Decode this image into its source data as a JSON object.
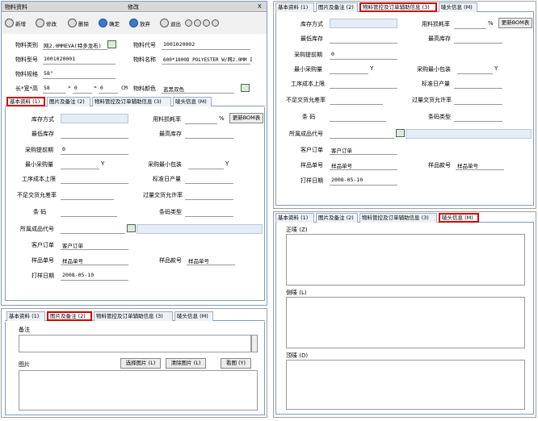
{
  "left_window": {
    "title": "物料资料",
    "center_title": "修改",
    "close": "X",
    "toolbar": [
      {
        "label": "新增",
        "icon": "new-icon"
      },
      {
        "label": "修改",
        "icon": "edit-icon"
      },
      {
        "label": "删除",
        "icon": "delete-icon"
      },
      {
        "label": "确定",
        "icon": "confirm-icon"
      },
      {
        "label": "放弃",
        "icon": "cancel-icon"
      },
      {
        "label": "退出",
        "icon": "exit-icon"
      }
    ],
    "header_fields": {
      "category_label": "物料类别",
      "category_value": "网2.0MMEVA(特多龙布)",
      "code_label": "物料代号",
      "code_value": "1001020002",
      "model_label": "物料型号",
      "model_value": "1001020001",
      "name_label": "物料名称",
      "name_value": "600*1800D POLYESTER W/网2.0MM I",
      "spec_label": "物料规格",
      "spec_value": "58\"",
      "dims_label": "长*宽*高",
      "dims_l": "58",
      "dims_x1": "* 0",
      "dims_x2": "* 0",
      "dims_unit": "CM",
      "color_label": "物料颜色",
      "color_value": "蓝黑双色"
    },
    "tabs": [
      "基本资料 (1)",
      "图片及备注 (2)",
      "物料管控及订单辅助信息 (3)",
      "唛头信息 (M)"
    ]
  },
  "basic": {
    "stock_method": "库存方式",
    "loss_rate": "用料损耗率",
    "percent": "%",
    "update_bom": "更新BOM表",
    "min_stock": "最低库存",
    "max_stock": "最高库存",
    "lead_days": "采购提前期",
    "lead_days_value": "0",
    "min_purchase": "最小采购量",
    "min_pack": "采购最小包装",
    "y_unit": "Y",
    "cost_limit": "工序成本上限",
    "std_output": "标准日产量",
    "shortage": "不足交货允差率",
    "overage": "过量交货允许率",
    "barcode": "条 码",
    "barcode_type": "条码类型",
    "finished_code": "所属成品代号",
    "customer_order": "客户订单",
    "customer_order_value": "客户订单",
    "sample_no": "样品单号",
    "sample_no_value": "样品单号",
    "sample_style": "样品款号",
    "sample_style_value": "样品单号",
    "print_date": "打样日期",
    "print_date_value": "2008-05-10"
  },
  "picture_tab": {
    "tabs": [
      "基本资料 (1)",
      "图片及备注 (2)",
      "物料管控及订单辅助信息 (3)",
      "唛头信息 (M)"
    ],
    "remark": "备注",
    "picture": "图片",
    "select_pic": "选择图片 (L)",
    "clear_pic": "清除图片 (L)",
    "view_pic": "看图 (Y)"
  },
  "control_tab": {
    "tabs": [
      "基本资料 (1)",
      "图片及备注 (2)",
      "物料管控及订单辅助信息 (3)",
      "唛头信息 (M)"
    ]
  },
  "mark_tab": {
    "tabs": [
      "基本资料 (1)",
      "图片及备注 (2)",
      "物料管控及订单辅助信息 (3)",
      "唛头信息 (M)"
    ],
    "front": "正唛 (Z)",
    "side": "侧唛 (L)",
    "top": "顶唛 (D)"
  }
}
